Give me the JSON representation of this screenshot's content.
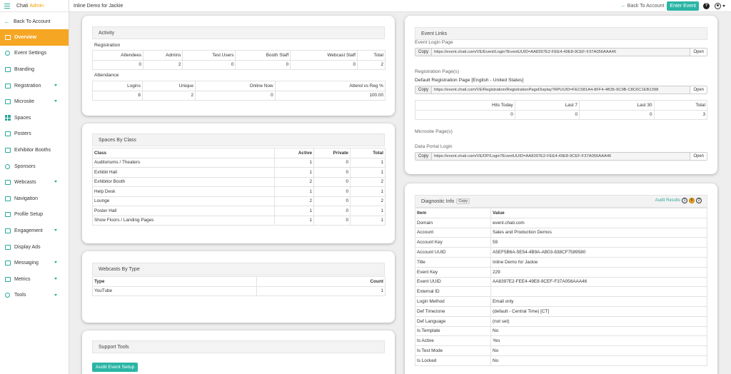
{
  "brand": {
    "name": "Chati",
    "accent": "Admin"
  },
  "sidebar": {
    "back": "Back To Account",
    "items": [
      {
        "label": "Overview",
        "icon": "home-icon",
        "active": true,
        "chevron": false
      },
      {
        "label": "Event Settings",
        "icon": "gear-icon",
        "chevron": false
      },
      {
        "label": "Branding",
        "icon": "image-icon",
        "chevron": false
      },
      {
        "label": "Registration",
        "icon": "registration-icon",
        "chevron": true
      },
      {
        "label": "Microsite",
        "icon": "browser-icon",
        "chevron": true
      },
      {
        "label": "Spaces",
        "icon": "grid-icon",
        "chevron": false
      },
      {
        "label": "Posters",
        "icon": "poster-icon",
        "chevron": false
      },
      {
        "label": "Exhibitor Booths",
        "icon": "booth-icon",
        "chevron": false
      },
      {
        "label": "Sponsors",
        "icon": "sponsor-icon",
        "chevron": false
      },
      {
        "label": "Webcasts",
        "icon": "broadcast-icon",
        "chevron": true
      },
      {
        "label": "Navigation",
        "icon": "sitemap-icon",
        "chevron": false
      },
      {
        "label": "Profile Setup",
        "icon": "profile-icon",
        "chevron": false
      },
      {
        "label": "Engagement",
        "icon": "handshake-icon",
        "chevron": true
      },
      {
        "label": "Display Ads",
        "icon": "ad-icon",
        "chevron": false
      },
      {
        "label": "Messaging",
        "icon": "message-icon",
        "chevron": true
      },
      {
        "label": "Metrics",
        "icon": "chart-icon",
        "chevron": true
      },
      {
        "label": "Tools",
        "icon": "tools-icon",
        "chevron": true
      }
    ]
  },
  "topbar": {
    "title": "Inline Demo for Jackie",
    "back": "Back To Account",
    "enter_event": "Enter Event",
    "help": "?"
  },
  "activity": {
    "title": "Activity",
    "registration_label": "Registration",
    "registration_headers": [
      "Attendees",
      "Admins",
      "Test Users",
      "Booth Staff",
      "Webcast Staff",
      "Total"
    ],
    "registration_values": [
      "0",
      "2",
      "0",
      "0",
      "0",
      "2"
    ],
    "attendance_label": "Attendance",
    "attendance_headers": [
      "Logins",
      "Unique",
      "Online Now",
      "Attend vs Reg %"
    ],
    "attendance_values": [
      "8",
      "2",
      "0",
      "100.00"
    ]
  },
  "spaces": {
    "title": "Spaces By Class",
    "headers": [
      "Class",
      "Active",
      "Private",
      "Total"
    ],
    "rows": [
      [
        "Auditoriums / Theaters",
        "1",
        "0",
        "1"
      ],
      [
        "Exhibit Hall",
        "1",
        "0",
        "1"
      ],
      [
        "Exhibitor Booth",
        "2",
        "0",
        "2"
      ],
      [
        "Help Desk",
        "1",
        "0",
        "1"
      ],
      [
        "Lounge",
        "2",
        "0",
        "2"
      ],
      [
        "Poster Hall",
        "1",
        "0",
        "1"
      ],
      [
        "Show Floors / Landing Pages",
        "1",
        "0",
        "1"
      ]
    ]
  },
  "webcasts": {
    "title": "Webcasts By Type",
    "headers": [
      "Type",
      "Count"
    ],
    "rows": [
      [
        "YouTube",
        "1"
      ]
    ]
  },
  "support": {
    "title": "Support Tools",
    "button": "Audit Event Setup"
  },
  "event_links": {
    "title": "Event Links",
    "login_label": "Event Login Page",
    "login_url": "https://event.chati.com/VE/Event/Login?EventUUID=AA8397E2-FEE4-49E8-9CEF-F37A056AAA46",
    "reg_pages_label": "Registration Page(s)",
    "default_reg_label": "Default Registration Page [English - United States]",
    "reg_url": "https://event.chati.com/VE/Registration/RegistrationPageDisplay?RPUUID=FEC581A4-8FF4-4B35-9C9B-C8C6C1EB1398",
    "hits_headers": [
      "Hits Today",
      "Last 7",
      "Last 30",
      "Total"
    ],
    "hits_values": [
      "0",
      "0",
      "0",
      "3"
    ],
    "microsite_label": "Microsite Page(s)",
    "portal_label": "Data Portal Login",
    "portal_url": "https://event.chati.com/VE/DP/Login?EventUUID=AA8397E2-FEE4-49E8-9CEF-F37A056AAA46",
    "copy": "Copy",
    "open": "Open"
  },
  "diagnostic": {
    "title": "Diagnostic Info",
    "copy": "Copy",
    "audit_label": "Audit Results",
    "audit_counts": [
      "1",
      "8",
      "2"
    ],
    "headers": [
      "Item",
      "Value"
    ],
    "rows": [
      [
        "Domain",
        "event.chati.com"
      ],
      [
        "Account",
        "Sales and Production Demos"
      ],
      [
        "Account Key",
        "59"
      ],
      [
        "Account UUID",
        "A5EF5B6A-5E54-4B9A-AB03-838CF7589580"
      ],
      [
        "Title",
        "Inline Demo for Jackie"
      ],
      [
        "Event Key",
        "229"
      ],
      [
        "Event UUID",
        "AA8397E2-FEE4-49E8-9CEF-F37A056AAA46"
      ],
      [
        "External ID",
        ""
      ],
      [
        "Login Method",
        "Email only"
      ],
      [
        "Def Timezone",
        "(default - Central Time) [CT]"
      ],
      [
        "Def Language",
        "(not set)"
      ],
      [
        "Is Template",
        "No"
      ],
      [
        "Is Active",
        "Yes"
      ],
      [
        "Is Test Mode",
        "No"
      ],
      [
        "Is Locked",
        "No"
      ]
    ]
  }
}
